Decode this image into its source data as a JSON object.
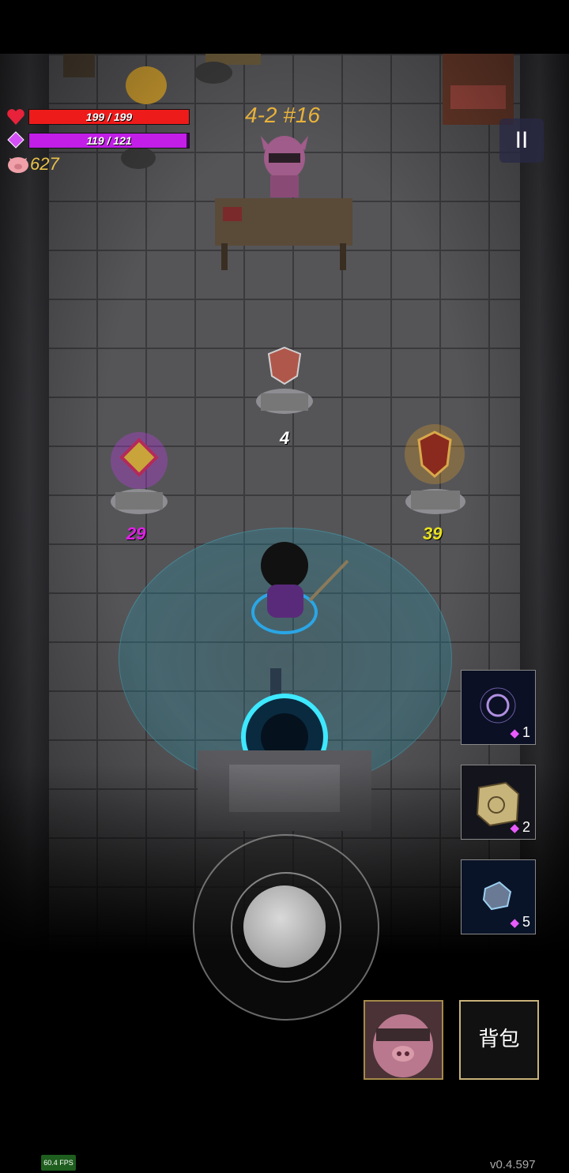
{
  "hud": {
    "hp_text": "199 / 199",
    "hp_current": 199,
    "hp_max": 199,
    "mp_text": "119 / 121",
    "mp_current": 119,
    "mp_max": 121,
    "coins": "627",
    "level": "4-2 #16",
    "pause_label": "II",
    "colors": {
      "hp": "#ee1b1b",
      "mp": "#c21ee8",
      "coins": "#e9c24a",
      "level": "#e8b23a"
    }
  },
  "world": {
    "price_center": "4",
    "price_left": "29",
    "price_right": "39",
    "price_colors": {
      "center": "#ffffff",
      "left": "#e020e8",
      "right": "#e8e020"
    }
  },
  "skills": [
    {
      "icon": "vortex-orb-icon",
      "cost": "1"
    },
    {
      "icon": "rune-cube-icon",
      "cost": "2"
    },
    {
      "icon": "crystal-rock-icon",
      "cost": "5"
    }
  ],
  "buttons": {
    "bag_label": "背包",
    "portrait_icon": "pig-merchant-portrait"
  },
  "footer": {
    "fps": "60.4 FPS",
    "version": "v0.4.597"
  }
}
